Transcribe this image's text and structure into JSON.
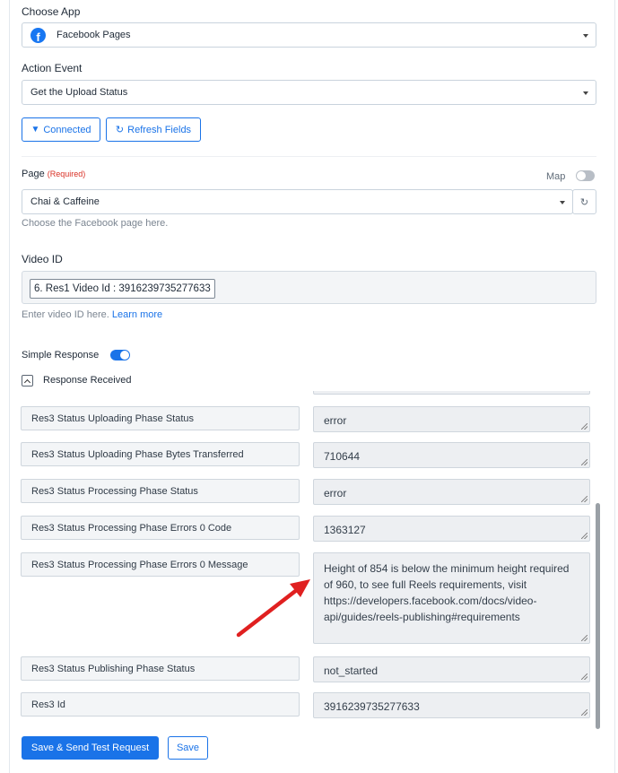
{
  "choose_app": {
    "label": "Choose App",
    "selected": "Facebook Pages",
    "icon": "facebook-icon"
  },
  "action_event": {
    "label": "Action Event",
    "selected": "Get the Upload Status"
  },
  "buttons": {
    "connected": "Connected",
    "refresh_fields": "Refresh Fields"
  },
  "page_field": {
    "label": "Page",
    "required": "(Required)",
    "map_label": "Map",
    "selected": "Chai & Caffeine",
    "hint": "Choose the Facebook page here."
  },
  "video_id": {
    "label": "Video ID",
    "value": "6. Res1 Video Id : 3916239735277633",
    "hint": "Enter video ID here.",
    "hint_link": "Learn more"
  },
  "simple_response": {
    "label": "Simple Response",
    "enabled": true
  },
  "response_received": {
    "label": "Response Received",
    "rows": [
      {
        "key": "Res3 Status Uploading Phase Status",
        "value": "error"
      },
      {
        "key": "Res3 Status Uploading Phase Bytes Transferred",
        "value": "710644"
      },
      {
        "key": "Res3 Status Processing Phase Status",
        "value": "error"
      },
      {
        "key": "Res3 Status Processing Phase Errors 0 Code",
        "value": "1363127"
      },
      {
        "key": "Res3 Status Processing Phase Errors 0 Message",
        "value": "Height of 854 is below the minimum height required of 960, to see full Reels requirements, visit https://developers.facebook.com/docs/video-api/guides/reels-publishing#requirements"
      },
      {
        "key": "Res3 Status Publishing Phase Status",
        "value": "not_started"
      },
      {
        "key": "Res3 Id",
        "value": "3916239735277633"
      }
    ]
  },
  "footer": {
    "save_send": "Save & Send Test Request",
    "save": "Save"
  },
  "colors": {
    "accent": "#1a73e8",
    "required": "#d93025",
    "annotation_arrow": "#e02020"
  }
}
